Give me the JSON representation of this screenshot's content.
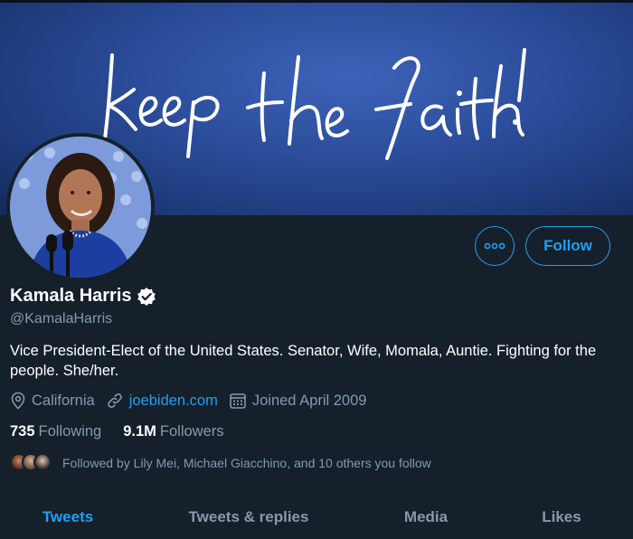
{
  "banner": {
    "text": "keep the faith!"
  },
  "profile": {
    "name": "Kamala Harris",
    "handle": "@KamalaHarris",
    "bio": "Vice President-Elect of the United States. Senator, Wife, Momala, Auntie. Fighting for the people. She/her.",
    "location": "California",
    "website": "joebiden.com",
    "joined": "Joined April 2009",
    "verified": true
  },
  "actions": {
    "follow_label": "Follow",
    "more_icon": "more-icon"
  },
  "stats": {
    "following_count": "735",
    "following_label": "Following",
    "followers_count": "9.1M",
    "followers_label": "Followers"
  },
  "followed_by": {
    "text": "Followed by Lily Mei, Michael Giacchino, and 10 others you follow"
  },
  "tabs": [
    {
      "label": "Tweets",
      "active": true
    },
    {
      "label": "Tweets & replies",
      "active": false
    },
    {
      "label": "Media",
      "active": false
    },
    {
      "label": "Likes",
      "active": false
    }
  ],
  "colors": {
    "accent": "#1da1f2",
    "background": "#15202b",
    "muted": "#8899a6"
  }
}
